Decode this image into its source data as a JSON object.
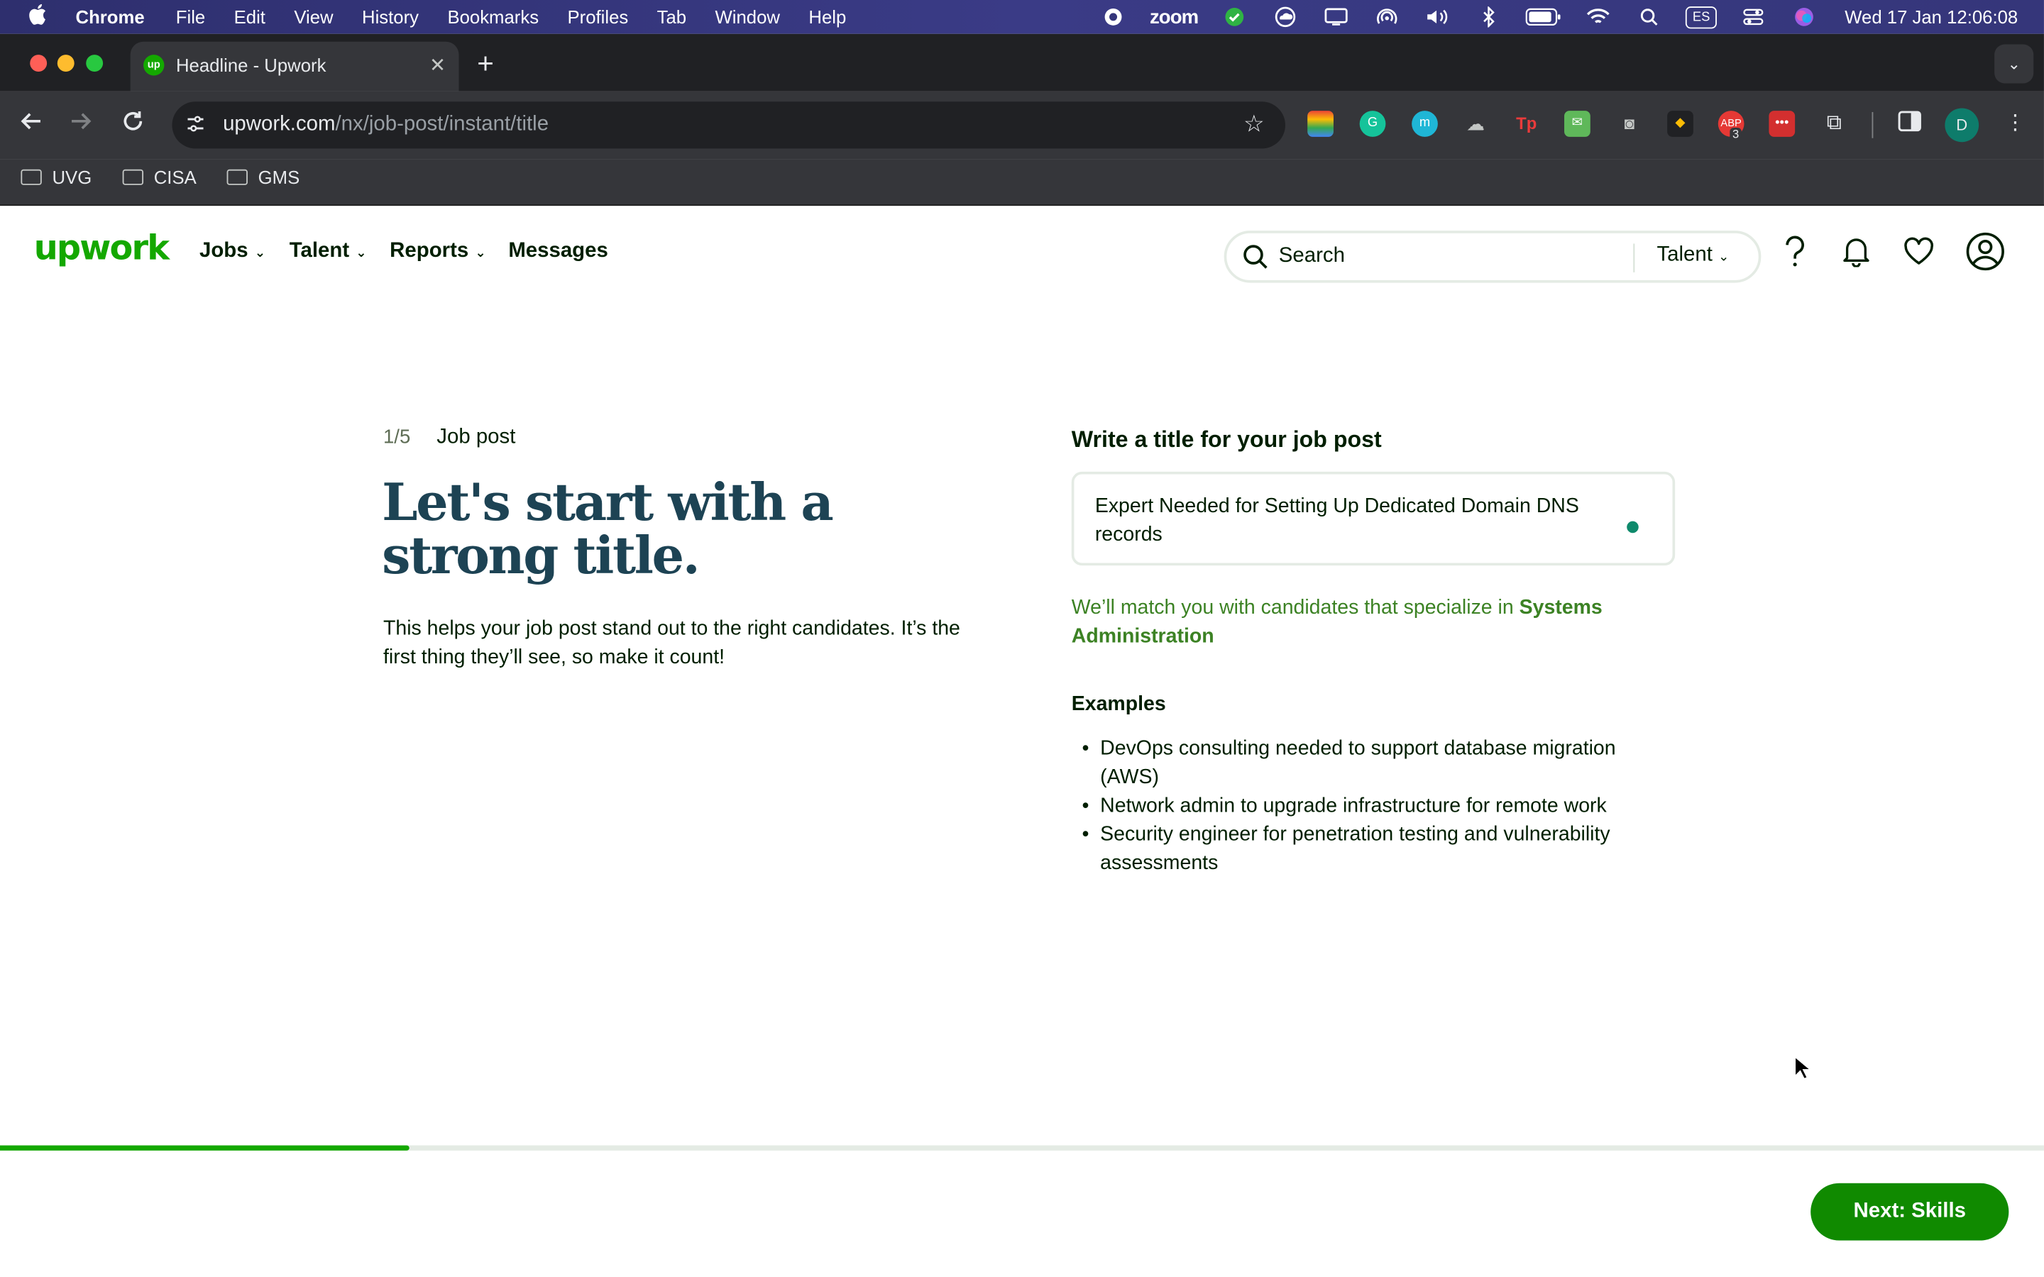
{
  "menubar": {
    "app": "Chrome",
    "items": [
      "File",
      "Edit",
      "View",
      "History",
      "Bookmarks",
      "Profiles",
      "Tab",
      "Window",
      "Help"
    ],
    "zoom_label": "zoom",
    "input_source": "ES",
    "clock": "Wed 17 Jan  12:06:08"
  },
  "browser": {
    "tab_title": "Headline - Upwork",
    "favicon_text": "up",
    "url_host": "upwork.com",
    "url_path": "/nx/job-post/instant/title",
    "profile_initial": "D",
    "extension_badge": "3",
    "bookmarks": [
      "UVG",
      "CISA",
      "GMS"
    ]
  },
  "header": {
    "logo": "upwork",
    "nav": [
      "Jobs",
      "Talent",
      "Reports",
      "Messages"
    ],
    "search_placeholder": "Search",
    "search_scope": "Talent"
  },
  "main": {
    "step": "1/5",
    "step_label": "Job post",
    "headline": "Let's start with a strong title.",
    "subtext": "This helps your job post stand out to the right candidates. It’s the first thing they’ll see, so make it count!",
    "field_label": "Write a title for your job post",
    "title_value": "Expert Needed for Setting Up Dedicated Domain DNS records",
    "match_prefix": "We’ll match you with candidates that specialize in ",
    "match_category": "Systems Administration",
    "examples_heading": "Examples",
    "examples": [
      "DevOps consulting needed to support database migration (AWS)",
      "Network admin to upgrade infrastructure for remote work",
      "Security engineer for penetration testing and vulnerability assessments"
    ]
  },
  "footer": {
    "progress_fraction": 0.2,
    "next_label": "Next: Skills"
  },
  "colors": {
    "brand_green": "#14a800",
    "button_green": "#108a00",
    "headline": "#1d4354",
    "match_text": "#3c8224"
  }
}
